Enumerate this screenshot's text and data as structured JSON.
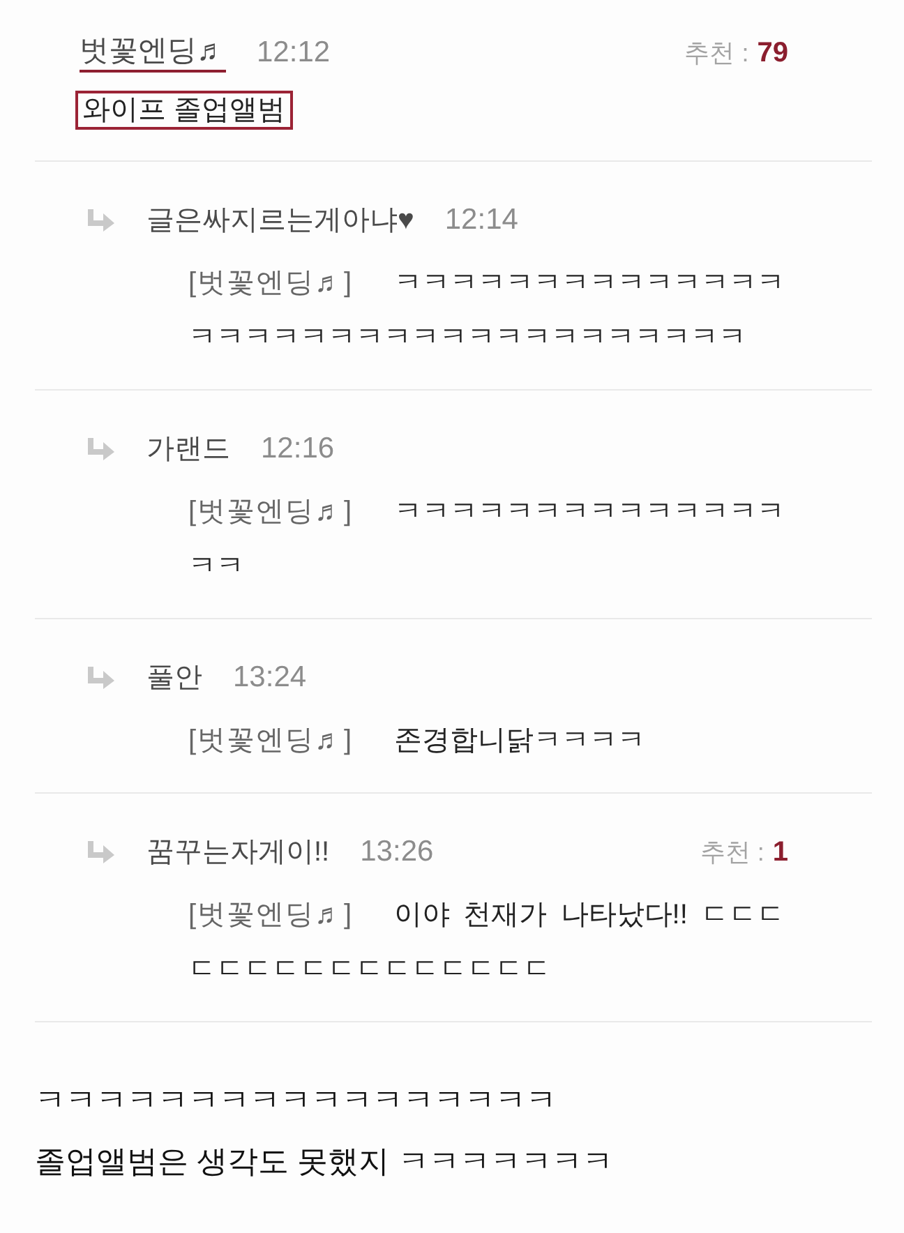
{
  "comment": {
    "author": "벗꽃엔딩♬",
    "author_underlined": true,
    "time": "12:12",
    "recommend": {
      "label": "추천 :",
      "count": "79"
    },
    "body": "와이프 졸업앨범",
    "body_boxed": true
  },
  "replies": [
    {
      "author": "글은싸지르는게아냐♥",
      "time": "12:14",
      "mention": "[벗꽃엔딩♬]",
      "body": "ㅋㅋㅋㅋㅋㅋㅋㅋㅋㅋㅋㅋㅋㅋㅋㅋㅋㅋㅋㅋㅋㅋㅋㅋㅋㅋㅋㅋㅋㅋㅋㅋㅋㅋ"
    },
    {
      "author": "가랜드",
      "time": "12:16",
      "mention": "[벗꽃엔딩♬]",
      "body": "ㅋㅋㅋㅋㅋㅋㅋㅋㅋㅋㅋㅋㅋㅋㅋㅋ"
    },
    {
      "author": "풀안",
      "time": "13:24",
      "mention": "[벗꽃엔딩♬]",
      "body": "존경합니닭ㅋㅋㅋㅋ"
    },
    {
      "author": "꿈꾸는자게이!!",
      "time": "13:26",
      "recommend": {
        "label": "추천 :",
        "count": "1"
      },
      "mention": "[벗꽃엔딩♬]",
      "body": "이야 천재가 나타났다!! ㄷㄷㄷㄷㄷㄷㄷㄷㄷㄷㄷㄷㄷㄷㄷㄷ"
    }
  ],
  "caption": [
    "ㅋㅋㅋㅋㅋㅋㅋㅋㅋㅋㅋㅋㅋㅋㅋㅋㅋ",
    "졸업앨범은 생각도 못했지 ㅋㅋㅋㅋㅋㅋㅋ"
  ]
}
